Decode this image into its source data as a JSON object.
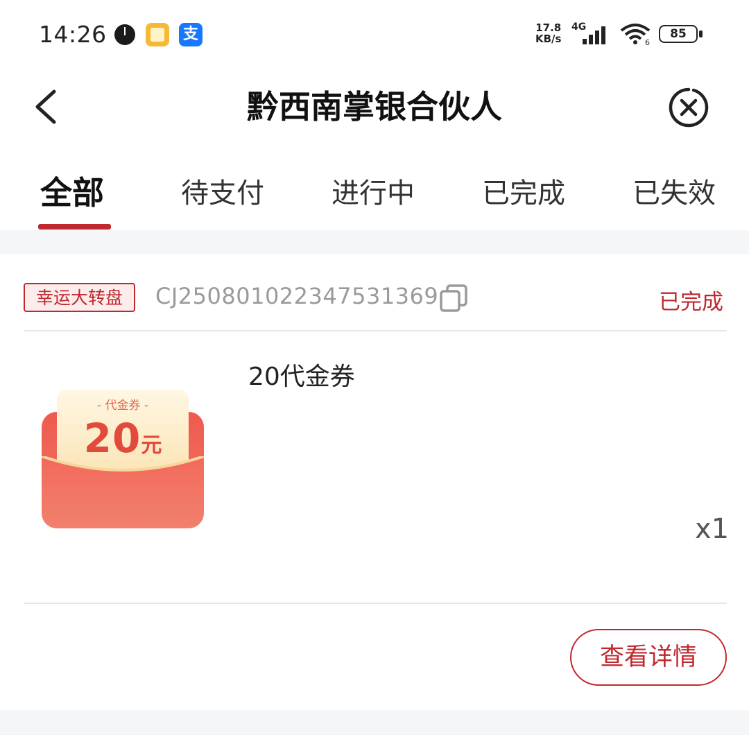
{
  "status_bar": {
    "time": "14:26",
    "net_speed_value": "17.8",
    "net_speed_unit": "KB/s",
    "network_type": "4G",
    "battery_level": "85",
    "icons": [
      "clock-app-icon",
      "notes-app-icon",
      "alipay-app-icon",
      "signal-icon",
      "wifi-icon",
      "battery-icon"
    ]
  },
  "nav": {
    "title": "黔西南掌银合伙人",
    "icons": [
      "back-arrow-icon",
      "close-icon"
    ]
  },
  "tabs": [
    {
      "label": "全部",
      "active": true
    },
    {
      "label": "待支付",
      "active": false
    },
    {
      "label": "进行中",
      "active": false
    },
    {
      "label": "已完成",
      "active": false
    },
    {
      "label": "已失效",
      "active": false
    }
  ],
  "order": {
    "tag": "幸运大转盘",
    "order_no": "CJ2508010223475313​69",
    "status": "已完成",
    "product_name": "20代金券",
    "quantity": "x1",
    "detail_button": "查看详情",
    "voucher": {
      "label": "- 代金券 -",
      "amount": "20",
      "unit": "元"
    }
  },
  "colors": {
    "accent": "#c0282e",
    "background": "#f5f6f8"
  }
}
